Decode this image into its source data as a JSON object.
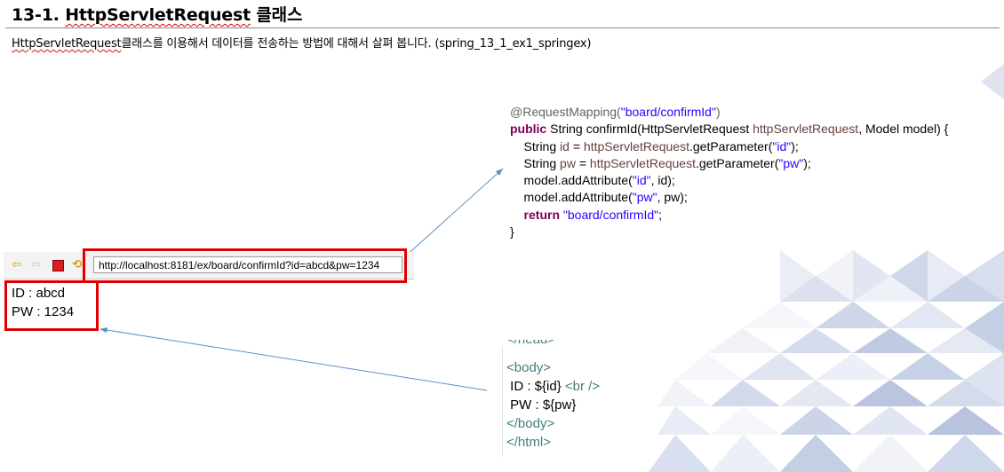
{
  "heading": {
    "number": "13-1.",
    "class_name": "HttpServletRequest",
    "suffix": "클래스"
  },
  "description": {
    "class_name": "HttpServletRequest",
    "text": "클래스를 이용해서 데이터를 전송하는 방법에 대해서 살펴 봅니다. (spring_13_1_ex1_springex)"
  },
  "java_code": {
    "l1_annotation": "@RequestMapping(",
    "l1_string": "\"board/confirmId\"",
    "l1_close": ")",
    "l2_kw": "public",
    "l2_a": " String confirmId(HttpServletRequest ",
    "l2_var": "httpServletRequest",
    "l2_b": ", Model model) {",
    "l3_a": "    String ",
    "l3_var": "id",
    "l3_b": " = ",
    "l3_var2": "httpServletRequest",
    "l3_c": ".getParameter(",
    "l3_str": "\"id\"",
    "l3_d": ");",
    "l4_a": "    String ",
    "l4_var": "pw",
    "l4_b": " = ",
    "l4_var2": "httpServletRequest",
    "l4_c": ".getParameter(",
    "l4_str": "\"pw\"",
    "l4_d": ");",
    "l5_a": "    model.addAttribute(",
    "l5_str": "\"id\"",
    "l5_b": ", id);",
    "l6_a": "    model.addAttribute(",
    "l6_str": "\"pw\"",
    "l6_b": ", pw);",
    "l7_kw": "    return",
    "l7_str": " \"board/confirmId\"",
    "l7_end": ";",
    "l8": "}"
  },
  "browser": {
    "url": "http://localhost:8181/ex/board/confirmId?id=abcd&pw=1234",
    "icons": [
      "back-arrow-icon",
      "forward-arrow-icon",
      "stop-icon",
      "refresh-icon"
    ]
  },
  "output": {
    "line1": "ID : abcd",
    "line2": "PW : 1234"
  },
  "html_code": {
    "cut_line": "</head>",
    "body_open": "<body>",
    "id_text": " ID : ${id} ",
    "br_tag": "<br />",
    "pw_text": " PW : ${pw}",
    "body_close": "</body>",
    "html_close": "</html>"
  },
  "colors": {
    "highlight_box": "#e00000",
    "arrow": "#5b8fc9",
    "java_keyword": "#7f0055",
    "java_string": "#2a00ff",
    "html_tag": "#3f7f7f"
  }
}
